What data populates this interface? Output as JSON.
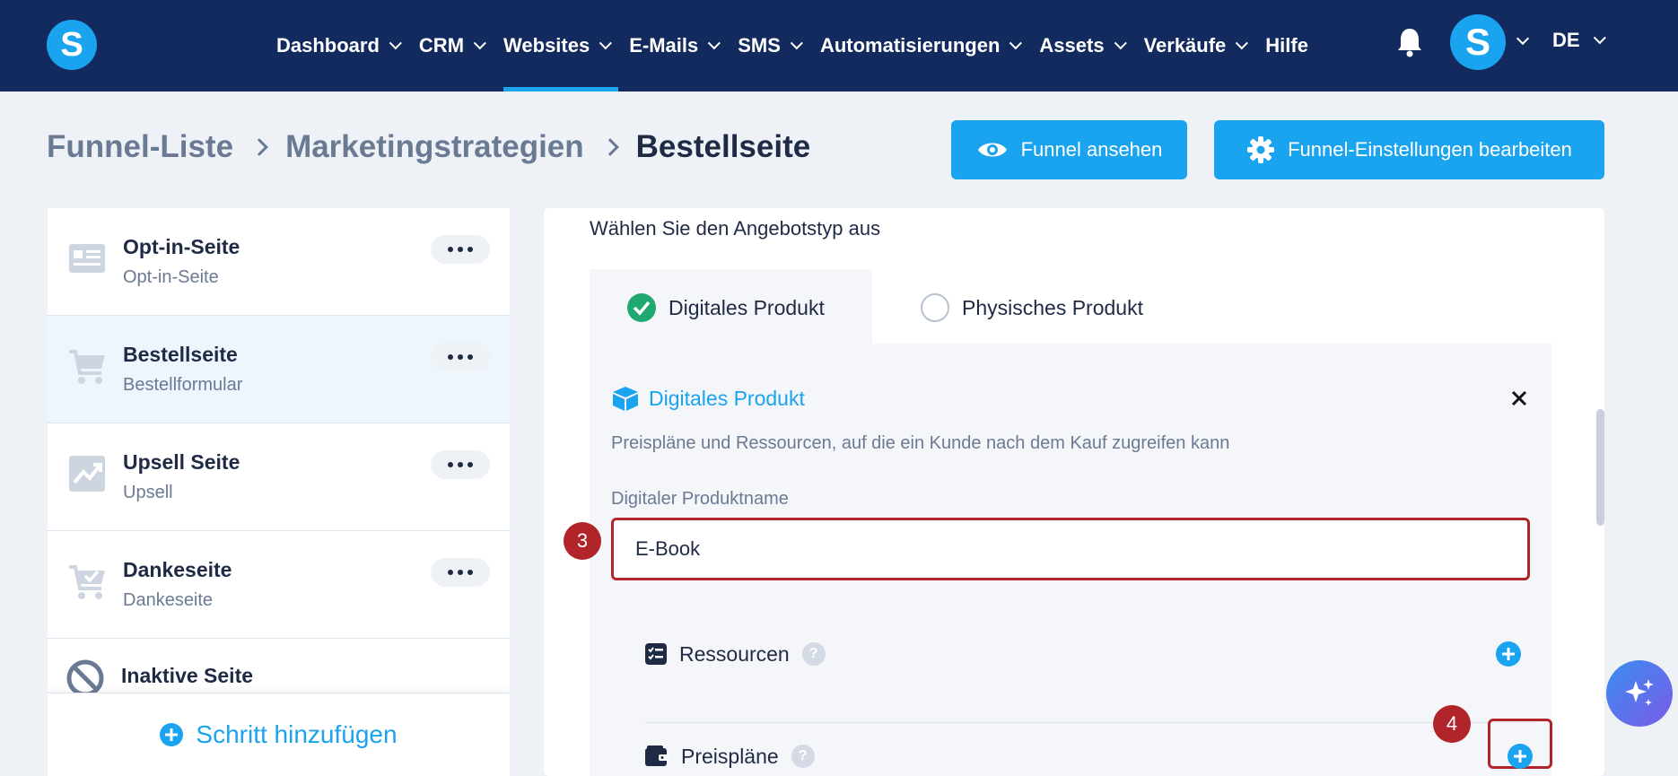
{
  "app": {
    "logo_letter": "S",
    "avatar_letter": "S",
    "language": "DE"
  },
  "nav": {
    "items": [
      {
        "label": "Dashboard",
        "dropdown": true
      },
      {
        "label": "CRM",
        "dropdown": true
      },
      {
        "label": "Websites",
        "dropdown": true,
        "active": true
      },
      {
        "label": "E-Mails",
        "dropdown": true
      },
      {
        "label": "SMS",
        "dropdown": true
      },
      {
        "label": "Automatisierungen",
        "dropdown": true
      },
      {
        "label": "Assets",
        "dropdown": true
      },
      {
        "label": "Verkäufe",
        "dropdown": true
      },
      {
        "label": "Hilfe",
        "dropdown": false
      }
    ]
  },
  "breadcrumb": {
    "items": [
      "Funnel-Liste",
      "Marketingstrategien",
      "Bestellseite"
    ]
  },
  "actions": {
    "view_funnel": "Funnel ansehen",
    "edit_settings": "Funnel-Einstellungen bearbeiten"
  },
  "steps": {
    "items": [
      {
        "title": "Opt-in-Seite",
        "subtitle": "Opt-in-Seite",
        "icon": "form-icon"
      },
      {
        "title": "Bestellseite",
        "subtitle": "Bestellformular",
        "icon": "cart-icon",
        "selected": true
      },
      {
        "title": "Upsell Seite",
        "subtitle": "Upsell",
        "icon": "trend-icon"
      },
      {
        "title": "Dankeseite",
        "subtitle": "Dankeseite",
        "icon": "cart-check-icon"
      },
      {
        "title": "Inaktive Seite",
        "subtitle": "",
        "icon": "ban-icon"
      }
    ],
    "add_step": "Schritt hinzufügen"
  },
  "offer": {
    "label": "Wählen Sie den Angebotstyp aus",
    "tabs": {
      "digital": "Digitales Produkt",
      "physical": "Physisches Produkt"
    },
    "card": {
      "title": "Digitales Produkt",
      "description": "Preispläne und Ressourcen, auf die ein Kunde nach dem Kauf zugreifen kann",
      "name_label": "Digitaler Produktname",
      "name_value": "E-Book",
      "resources": "Ressourcen",
      "price_plans": "Preispläne",
      "help": "?"
    }
  },
  "annotations": {
    "step3": "3",
    "step4": "4"
  },
  "colors": {
    "nav_bg": "#132a5e",
    "accent": "#1aa3ef",
    "highlight": "#b1242a",
    "check": "#1fa971"
  }
}
